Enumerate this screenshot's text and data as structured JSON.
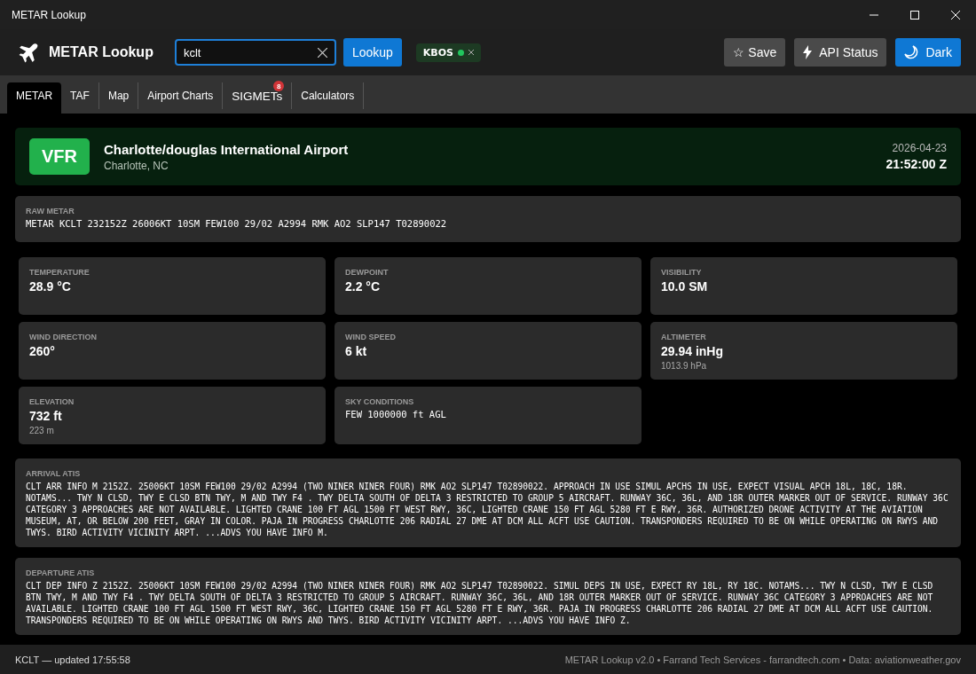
{
  "window": {
    "title": "METAR Lookup"
  },
  "header": {
    "app_name": "METAR Lookup",
    "search": {
      "value": "kclt"
    },
    "lookup_button": "Lookup",
    "favorites": [
      {
        "code": "KBOS"
      }
    ],
    "buttons": [
      {
        "kind": "save",
        "label": "☆ Save"
      },
      {
        "kind": "status",
        "label": "API Status"
      },
      {
        "kind": "theme",
        "label": "Dark"
      }
    ]
  },
  "tabs": [
    {
      "label": "METAR",
      "selected": true
    },
    {
      "label": "TAF",
      "selected": false
    },
    {
      "label": "Map",
      "selected": false
    },
    {
      "label": "Airport Charts",
      "selected": false
    },
    {
      "label": "SIGMETs",
      "selected": false,
      "badge": "8"
    },
    {
      "label": "Calculators",
      "selected": false
    }
  ],
  "station": {
    "category": "VFR",
    "name": "Charlotte/douglas International Airport",
    "location": "Charlotte, NC",
    "date": "2026-04-23",
    "time": "21:52:00 Z"
  },
  "raw_metar": {
    "label": "RAW METAR",
    "text": "METAR KCLT 232152Z 26006KT 10SM FEW100 29/02 A2994 RMK AO2 SLP147 T02890022"
  },
  "stats": [
    {
      "label": "TEMPERATURE",
      "value": "28.9 °C"
    },
    {
      "label": "DEWPOINT",
      "value": "2.2 °C"
    },
    {
      "label": "VISIBILITY",
      "value": "10.0 SM"
    },
    {
      "label": "WIND DIRECTION",
      "value": "260°"
    },
    {
      "label": "WIND SPEED",
      "value": "6 kt"
    },
    {
      "label": "ALTIMETER",
      "value": "29.94 inHg",
      "sub": "1013.9 hPa"
    },
    {
      "label": "ELEVATION",
      "value": "732 ft",
      "sub": "223 m"
    },
    {
      "label": "SKY CONDITIONS",
      "value": "FEW 1000000 ft AGL",
      "kind": "mono"
    }
  ],
  "atis": [
    {
      "label": "ARRIVAL ATIS",
      "text": "CLT ARR INFO M 2152Z. 25006KT 10SM FEW100 29/02 A2994 (TWO NINER NINER FOUR) RMK AO2 SLP147 T02890022. APPROACH IN USE SIMUL APCHS IN USE, EXPECT VISUAL APCH 18L, 18C, 18R. NOTAMS... TWY N CLSD, TWY E CLSD BTN TWY, M AND TWY F4 . TWY DELTA SOUTH OF DELTA 3 RESTRICTED TO GROUP 5 AIRCRAFT. RUNWAY 36C, 36L, AND 18R OUTER MARKER OUT OF SERVICE. RUNWAY 36C CATEGORY 3 APPROACHES ARE NOT AVAILABLE. LIGHTED CRANE 100 FT AGL 1500 FT WEST RWY, 36C, LIGHTED CRANE 150 FT AGL 5280 FT E RWY, 36R. AUTHORIZED DRONE ACTIVITY AT THE AVIATION MUSEUM, AT, OR BELOW 200 FEET, GRAY IN COLOR. PAJA IN PROGRESS CHARLOTTE 206 RADIAL 27 DME AT DCM ALL ACFT USE CAUTION. TRANSPONDERS REQUIRED TO BE ON WHILE OPERATING ON RWYS AND TWYS. BIRD ACTIVITY VICINITY ARPT. ...ADVS YOU HAVE INFO M."
    },
    {
      "label": "DEPARTURE ATIS",
      "text": "CLT DEP INFO Z 2152Z. 25006KT 10SM FEW100 29/02 A2994 (TWO NINER NINER FOUR) RMK AO2 SLP147 T02890022. SIMUL DEPS IN USE,  EXPECT RY 18L, RY 18C. NOTAMS... TWY N CLSD, TWY E CLSD BTN TWY, M AND TWY F4 . TWY DELTA SOUTH OF DELTA 3 RESTRICTED TO GROUP 5 AIRCRAFT. RUNWAY 36C, 36L, AND 18R OUTER MARKER OUT OF SERVICE. RUNWAY 36C CATEGORY 3 APPROACHES ARE NOT AVAILABLE. LIGHTED CRANE 100 FT AGL 1500 FT WEST RWY, 36C, LIGHTED CRANE 150 FT AGL 5280 FT E RWY, 36R. PAJA IN PROGRESS CHARLOTTE 206 RADIAL 27 DME AT DCM ALL ACFT USE CAUTION. TRANSPONDERS REQUIRED TO BE ON WHILE OPERATING ON RWYS AND TWYS. BIRD ACTIVITY VICINITY ARPT. ...ADVS YOU HAVE INFO Z."
    }
  ],
  "status_bar": {
    "left": "KCLT — updated 17:55:58",
    "right": "METAR Lookup v2.0 • Farrand Tech Services - farrandtech.com • Data: aviationweather.gov"
  }
}
